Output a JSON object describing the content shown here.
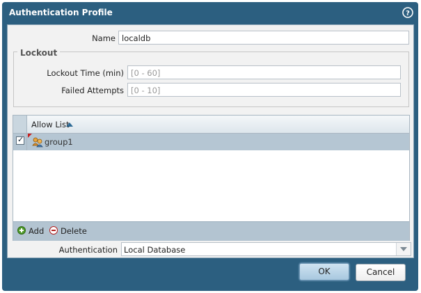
{
  "dialog": {
    "title": "Authentication Profile",
    "help_icon": "help-icon"
  },
  "form": {
    "name_label": "Name",
    "name_value": "localdb",
    "lockout": {
      "legend": "Lockout",
      "lockout_time_label": "Lockout Time (min)",
      "lockout_time_placeholder": "[0 - 60]",
      "failed_attempts_label": "Failed Attempts",
      "failed_attempts_placeholder": "[0 - 10]"
    },
    "allow_list": {
      "column_header": "Allow List",
      "sort": "ascending",
      "rows": [
        {
          "label": "group1",
          "checked": true,
          "icon": "group-icon"
        }
      ],
      "add_label": "Add",
      "delete_label": "Delete"
    },
    "authentication_label": "Authentication",
    "authentication_value": "Local Database"
  },
  "buttons": {
    "ok": "OK",
    "cancel": "Cancel"
  },
  "colors": {
    "frame": "#2c5f80",
    "grid_row_selected": "#b5c6d3",
    "add_icon": "#4e9a2a",
    "delete_icon": "#b21e1e"
  }
}
